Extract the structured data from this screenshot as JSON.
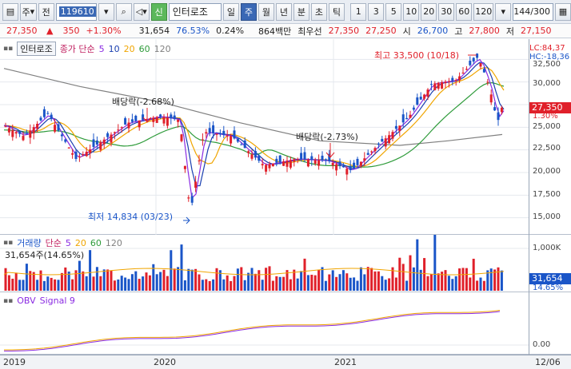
{
  "toolbar": {
    "market": "주",
    "type": "전",
    "code": "119610",
    "credit_badge": "신",
    "name": "인터로조",
    "periods": [
      "일",
      "주",
      "월",
      "년",
      "분",
      "초",
      "틱"
    ],
    "selected_period": "주",
    "numbers": [
      "1",
      "3",
      "5",
      "10",
      "20",
      "30",
      "60",
      "120"
    ],
    "count_current": "144",
    "count_total": "/300"
  },
  "quote": {
    "price": "27,350",
    "arrow": "▲",
    "change": "350",
    "change_pct": "+1.30%",
    "volume": "31,654",
    "vol_ratio": "76.53%",
    "turnover": "0.24%",
    "amount": "864백만",
    "best_ask_label": "최우선",
    "best_ask": "27,350",
    "best_bid": "27,250",
    "open_label": "시",
    "open": "26,700",
    "high_label": "고",
    "high": "27,800",
    "low_label": "저",
    "low": "27,150"
  },
  "price_panel": {
    "tag": "인터로조",
    "indicator": "종가 단순",
    "ma_periods": [
      "5",
      "10",
      "20",
      "60",
      "120"
    ],
    "lc": "LC:84,37",
    "hc": "HC:-18,36",
    "current_price": "27,350",
    "current_pct": "1.30%",
    "y_ticks": [
      "32,500",
      "30,000",
      "27,500",
      "25,000",
      "22,500",
      "20,000",
      "17,500",
      "15,000"
    ],
    "annotations": {
      "high": "최고 33,500 (10/18)",
      "low": "최저 14,834 (03/23)",
      "dividend1": "배당락(-2.68%)",
      "dividend2": "배당락(-2.73%)"
    }
  },
  "volume_panel": {
    "label": "거래량",
    "indicator": "단순",
    "ma_periods": [
      "5",
      "20",
      "60",
      "120"
    ],
    "current": "31,654주(14.65%)",
    "y_ticks": [
      "1,000K"
    ],
    "value_box": "31,654",
    "pct": "14.65%"
  },
  "obv_panel": {
    "label": "OBV",
    "signal": "Signal 9",
    "y_ticks": [
      "0.00"
    ]
  },
  "x_axis": [
    "2019",
    "2020",
    "2021",
    "12/06"
  ],
  "colors": {
    "up": "#e0202a",
    "down": "#1a55c8",
    "ma5": "#8a2be2",
    "ma10": "#1a3fb0",
    "ma20": "#f0a500",
    "ma60": "#2e9b3a",
    "ma120": "#808080"
  }
}
